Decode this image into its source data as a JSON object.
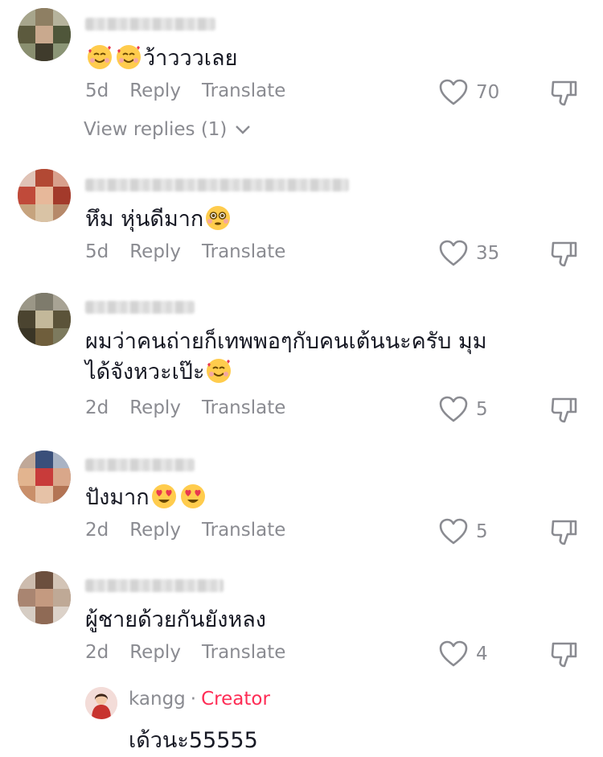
{
  "comments": [
    {
      "text": "ว้าวววเลย",
      "emojis_before": 2,
      "emoji_type": "smiling-face-with-hearts",
      "time": "5d",
      "reply": "Reply",
      "translate": "Translate",
      "likes": "70",
      "view_replies": "View replies (1)"
    },
    {
      "text": "หึม หุ่นดีมาก",
      "emoji_type": "flushed-face",
      "time": "5d",
      "reply": "Reply",
      "translate": "Translate",
      "likes": "35"
    },
    {
      "text_line1": "ผมว่าคนถ่ายก็เทพพอๆกับคนเต้นนะครับ มุม",
      "text_line2": "ได้จังหวะเป๊ะ",
      "emoji_type": "smiling-face-with-hearts",
      "time": "2d",
      "reply": "Reply",
      "translate": "Translate",
      "likes": "5"
    },
    {
      "text": "ปังมาก",
      "emoji_type": "heart-eyes-face",
      "time": "2d",
      "reply": "Reply",
      "translate": "Translate",
      "likes": "5"
    },
    {
      "text": "ผู้ชายด้วยกันยังหลง",
      "time": "2d",
      "reply": "Reply",
      "translate": "Translate",
      "likes": "4"
    }
  ],
  "creator_reply": {
    "username": "kangg",
    "separator": "·",
    "badge": "Creator",
    "text": "เด้วนะ55555"
  },
  "colors": {
    "text": "#161823",
    "secondary": "#8a8b91",
    "creator": "#fe2c55"
  },
  "icons": [
    "heart-outline-icon",
    "dislike-icon",
    "chevron-down-icon"
  ]
}
